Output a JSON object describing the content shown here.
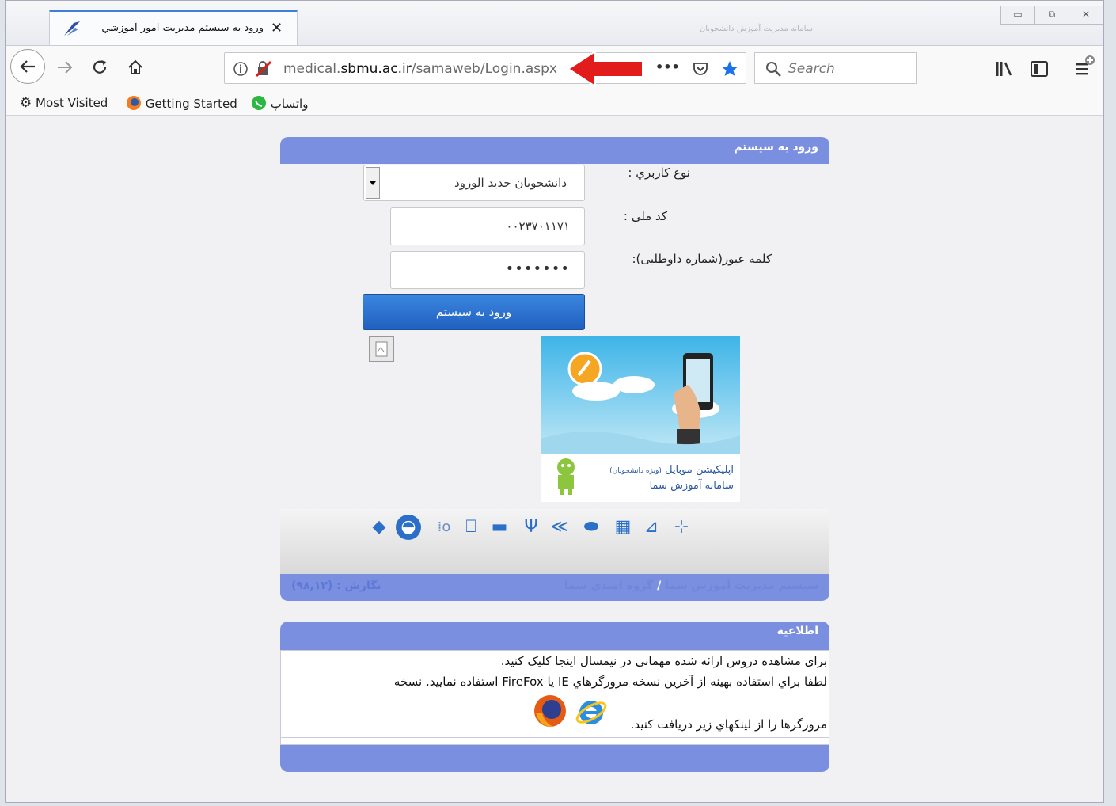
{
  "browser": {
    "tab_title": "ورود به سيستم مديريت امور آموزشي",
    "tab_close": "✕",
    "background_blur_text": "سامانه مدیریت آموزش دانشجویان",
    "url_prefix": "medical.",
    "url_host": "sbmu.ac.ir",
    "url_path": "/samaweb/Login.aspx",
    "search_placeholder": "Search",
    "page_actions": "•••",
    "window_controls": [
      "▭",
      "⧉",
      "✕"
    ]
  },
  "bookmarks": {
    "most_visited": "Most Visited",
    "getting_started": "Getting Started",
    "whatsapp": "واتساپ"
  },
  "login": {
    "header": "ورود به سیستم",
    "user_type_label": "نوع كاربري :",
    "user_type_value": "دانشجويان جديد الورود",
    "national_code_label": "کد ملی :",
    "national_code_value": "۰۰۲۳۷۰۱۱۷۱",
    "password_label": "كلمه عبور(شماره داوطلبی):",
    "password_value": "•••••••",
    "submit_label": "ورود به سیستم",
    "app_banner_title": "اپلیکیشن موبایل",
    "app_banner_note": "(ویژه دانشجویان)",
    "app_banner_subtitle": "سامانه آموزش سما",
    "footer_system": "سیستم مدیریت آموزش سما",
    "footer_sep": "/",
    "footer_group": "گروه امیدی سما",
    "footer_version": "نگارش : (۹۸,۱۲)"
  },
  "notice": {
    "header": "اطلاعیه",
    "line1": "برای مشاهده دروس ارائه شده مهمانی در نیمسال اینجا کلیک کنید.",
    "line2": "لطفا براي استفاده بهينه از آخرين نسخه مرورگرهاي IE يا FireFox استفاده نماييد. نسخه",
    "line3": "مرورگرها را از لينکهاي زير دريافت کنيد."
  },
  "colors": {
    "panel_blue": "#7b8fe0",
    "button_blue": "#2a6fd0",
    "accent_red": "#e21b1b",
    "star_blue": "#1a73e8"
  }
}
